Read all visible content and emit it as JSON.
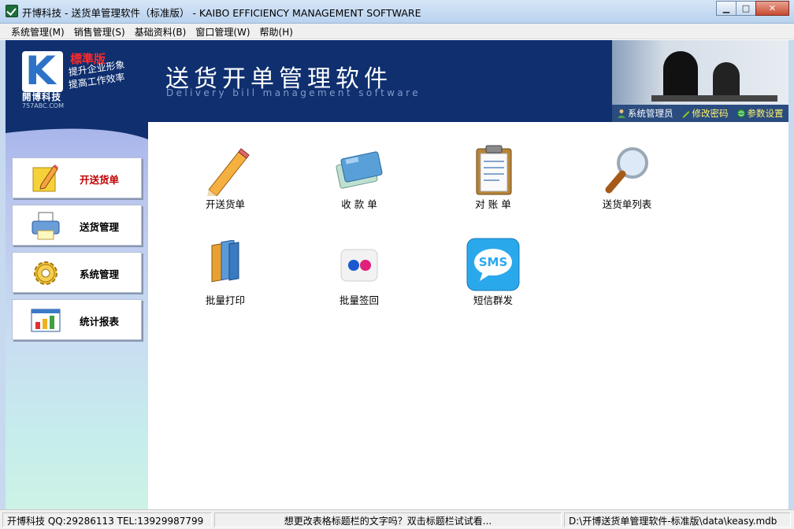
{
  "window": {
    "title": "开博科技 - 送货单管理软件（标准版） - KAIBO EFFICIENCY MANAGEMENT SOFTWARE",
    "minimize_glyph": "▁",
    "maximize_glyph": "□",
    "close_glyph": "✕"
  },
  "menubar": {
    "items": [
      {
        "label": "系统管理(M)"
      },
      {
        "label": "销售管理(S)"
      },
      {
        "label": "基础资料(B)"
      },
      {
        "label": "窗口管理(W)"
      },
      {
        "label": "帮助(H)"
      }
    ]
  },
  "banner": {
    "logo_letter": "K",
    "edition": "標準版",
    "slogan_line1": "提升企业形象",
    "slogan_line2": "提高工作效率",
    "brand_name": "開博科技",
    "brand_url": "757ABC.COM",
    "title": "送货开单管理软件",
    "subtitle": "Delivery bill management software",
    "user": "系统管理员",
    "change_password": "修改密码",
    "settings": "参数设置"
  },
  "sidebar": {
    "items": [
      {
        "label": "开送货单",
        "icon": "pencil-note-icon",
        "active": true
      },
      {
        "label": "送货管理",
        "icon": "printer-icon",
        "active": false
      },
      {
        "label": "系统管理",
        "icon": "gear-icon",
        "active": false
      },
      {
        "label": "统计报表",
        "icon": "bar-chart-icon",
        "active": false
      }
    ]
  },
  "main": {
    "tiles": [
      {
        "label": "开送货单",
        "icon": "pencil-icon"
      },
      {
        "label": "收 款 单",
        "icon": "payment-card-icon"
      },
      {
        "label": "对 账 单",
        "icon": "clipboard-icon"
      },
      {
        "label": "送货单列表",
        "icon": "magnifier-icon"
      },
      {
        "label": "批量打印",
        "icon": "folders-icon"
      },
      {
        "label": "批量签回",
        "icon": "flickr-dots-icon"
      },
      {
        "label": "短信群发",
        "icon": "sms-icon"
      }
    ],
    "sms_badge": "SMS"
  },
  "statusbar": {
    "company": "开博科技 QQ:29286113 TEL:13929987799",
    "hint": "想更改表格标题栏的文字吗？双击标题栏试试看...",
    "path": "D:\\开博送货单管理软件-标准版\\data\\keasy.mdb"
  },
  "colors": {
    "banner_bg": "#0f2f6f",
    "active_label": "#c00000",
    "link_yellow": "#fff36b"
  }
}
